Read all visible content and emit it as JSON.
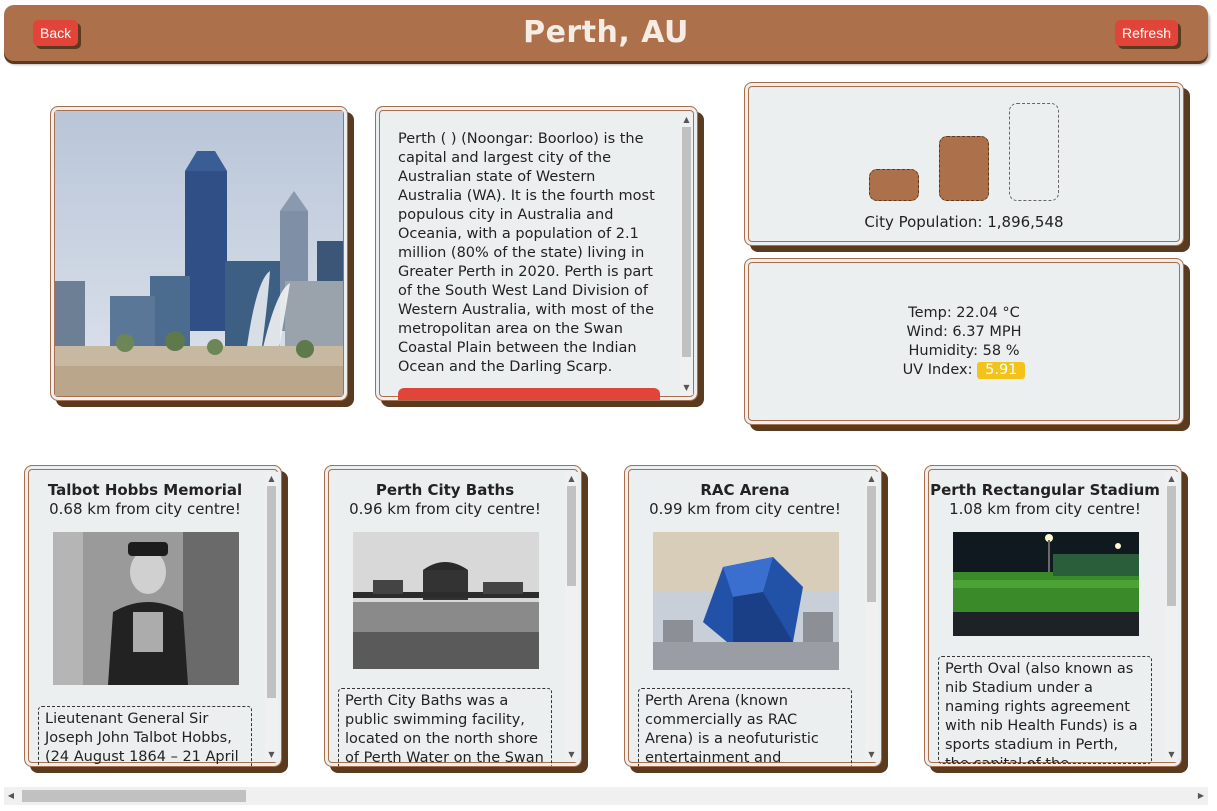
{
  "header": {
    "title": "Perth, AU",
    "back_label": "Back",
    "refresh_label": "Refresh"
  },
  "city": {
    "description": "Perth ( ) (Noongar: Boorloo) is the capital and largest city of the Australian state of Western Australia (WA). It is the fourth most populous city in Australia and Oceania, with a population of 2.1 million (80% of the state) living in Greater Perth in 2020. Perth is part of the South West Land Division of Western Australia, with most of the metropolitan area on the Swan Coastal Plain between the Indian Ocean and the Darling Scarp.",
    "population_label": "City Population: 1,896,548",
    "population_level": 2,
    "population_levels_total": 3
  },
  "weather": {
    "temp": "Temp: 22.04 °C",
    "wind": "Wind: 6.37 MPH",
    "humidity": "Humidity: 58 %",
    "uv_label": "UV Index:",
    "uv_value": "5.91",
    "uv_color": "#f3c31a"
  },
  "attractions": [
    {
      "name": "Talbot Hobbs Memorial",
      "distance": "0.68 km from city centre!",
      "description": "Lieutenant General Sir Joseph John Talbot Hobbs, (24 August 1864 – 21 April",
      "image_icon": "portrait-photo-icon"
    },
    {
      "name": "Perth City Baths",
      "distance": "0.96 km from city centre!",
      "description": "Perth City Baths was a public swimming facility, located on the north shore of Perth Water on the Swan",
      "image_icon": "baths-photo-icon"
    },
    {
      "name": "RAC Arena",
      "distance": "0.99 km from city centre!",
      "description": "Perth Arena (known commercially as RAC Arena) is a neofuturistic entertainment and sporting",
      "image_icon": "arena-photo-icon"
    },
    {
      "name": "Perth Rectangular Stadium",
      "distance": "1.08 km from city centre!",
      "description": "Perth Oval (also known as nib Stadium under a naming rights agreement with nib Health Funds) is a sports stadium in Perth, the capital of the Australian",
      "image_icon": "stadium-photo-icon"
    }
  ],
  "colors": {
    "brand_brown": "#ac714b",
    "button_red": "#e1453a",
    "card_bg": "#eceff0"
  }
}
